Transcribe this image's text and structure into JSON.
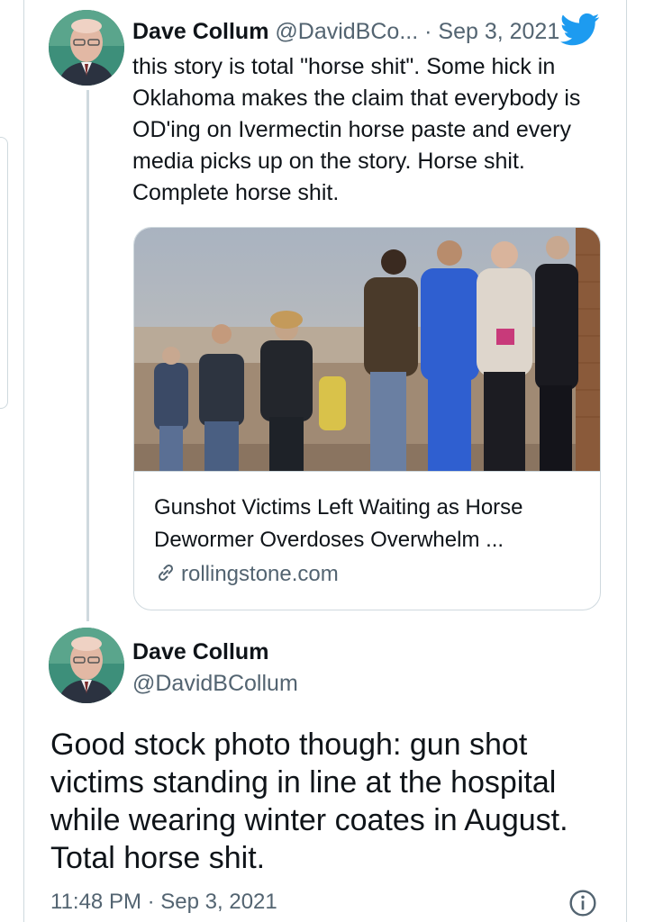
{
  "tweet1": {
    "author_name": "Dave Collum",
    "author_handle": "@DavidBCo...",
    "separator": "·",
    "date": "Sep 3, 2021",
    "text": "this story is total \"horse shit\". Some hick in Oklahoma makes the claim that everybody is OD'ing on Ivermectin horse paste and every media picks up on the story. Horse shit. Complete horse shit.",
    "source_icon": "twitter-bird-icon"
  },
  "link_card": {
    "title": "Gunshot Victims Left Waiting as Horse Dewormer Overdoses Overwhelm ...",
    "domain": "rollingstone.com",
    "link_icon": "link-icon"
  },
  "tweet2": {
    "author_name": "Dave Collum",
    "author_handle": "@DavidBCollum",
    "text": "Good stock photo though: gun shot victims standing in line at the hospital while wearing winter coates in August. Total horse shit.",
    "time": "11:48 PM",
    "separator": "·",
    "date": "Sep 3, 2021",
    "info_icon": "info-icon"
  },
  "colors": {
    "text": "#0f1419",
    "muted": "#536471",
    "border": "#cfd9de",
    "twitter_blue": "#1d9bf0"
  }
}
